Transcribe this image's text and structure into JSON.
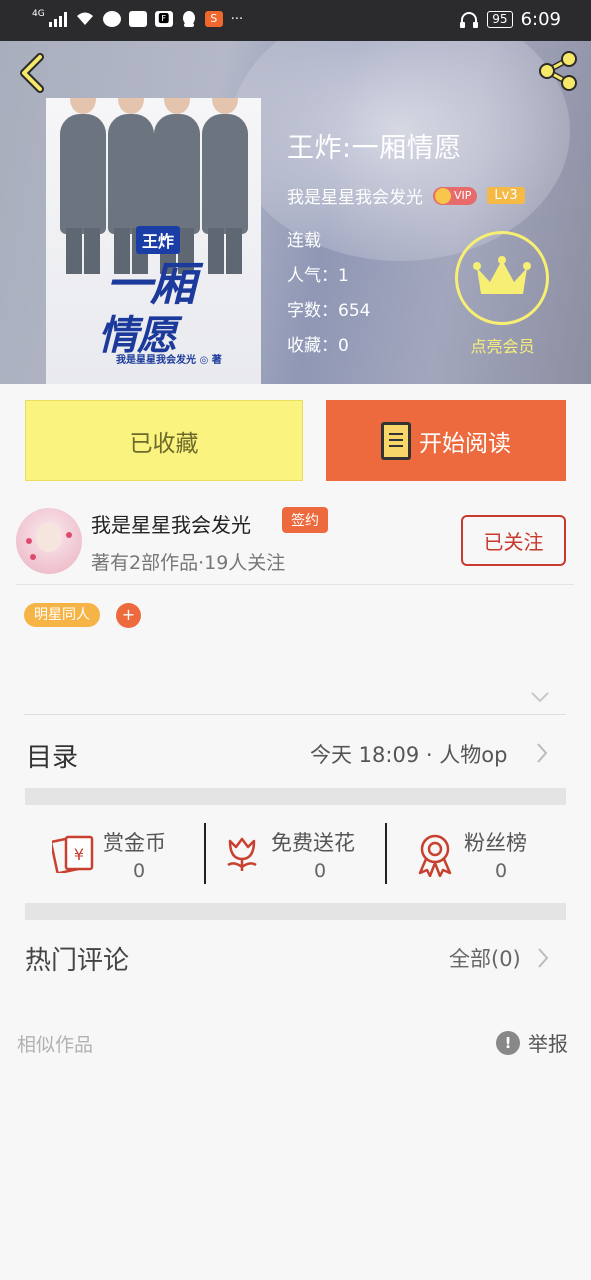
{
  "status_bar": {
    "network": "4G",
    "battery": "95",
    "time": "6:09",
    "app_icon_labels": [
      "🅵",
      "S"
    ],
    "more": "···"
  },
  "book": {
    "title": "王炸:一厢情愿",
    "author": "我是星星我会发光",
    "vip_label": "VIP",
    "level": "Lv3",
    "status": "连载",
    "popularity": "人气：1",
    "word_count": "字数：654",
    "favorites": "收藏：0",
    "cover": {
      "tag": "王炸",
      "title_line1": "一厢",
      "title_line2": "情愿",
      "author_line": "我是星星我会发光 ◎ 著"
    }
  },
  "member": {
    "label": "点亮会员"
  },
  "actions": {
    "favorited_label": "已收藏",
    "read_label": "开始阅读"
  },
  "author_card": {
    "name": "我是星星我会发光",
    "signed_badge": "签约",
    "stats": "著有2部作品·19人关注",
    "follow_label": "已关注"
  },
  "tags": {
    "items": [
      "明星同人"
    ],
    "add_label": "+"
  },
  "toc": {
    "label": "目录",
    "latest": "今天 18:09 · 人物op"
  },
  "stats": {
    "reward": {
      "label": "赏金币",
      "value": "0"
    },
    "flowers": {
      "label": "免费送花",
      "value": "0"
    },
    "fans": {
      "label": "粉丝榜",
      "value": "0"
    }
  },
  "comments": {
    "label": "热门评论",
    "all_label": "全部(0)"
  },
  "footer": {
    "similar": "相似作品",
    "report": "举报",
    "report_icon": "!"
  },
  "colors": {
    "accent_orange": "#ed6a3e",
    "favorite_yellow": "#fbf37f",
    "member_yellow": "#f6ef74",
    "follow_red": "#c83a2e",
    "tag_orange": "#f6b346"
  }
}
